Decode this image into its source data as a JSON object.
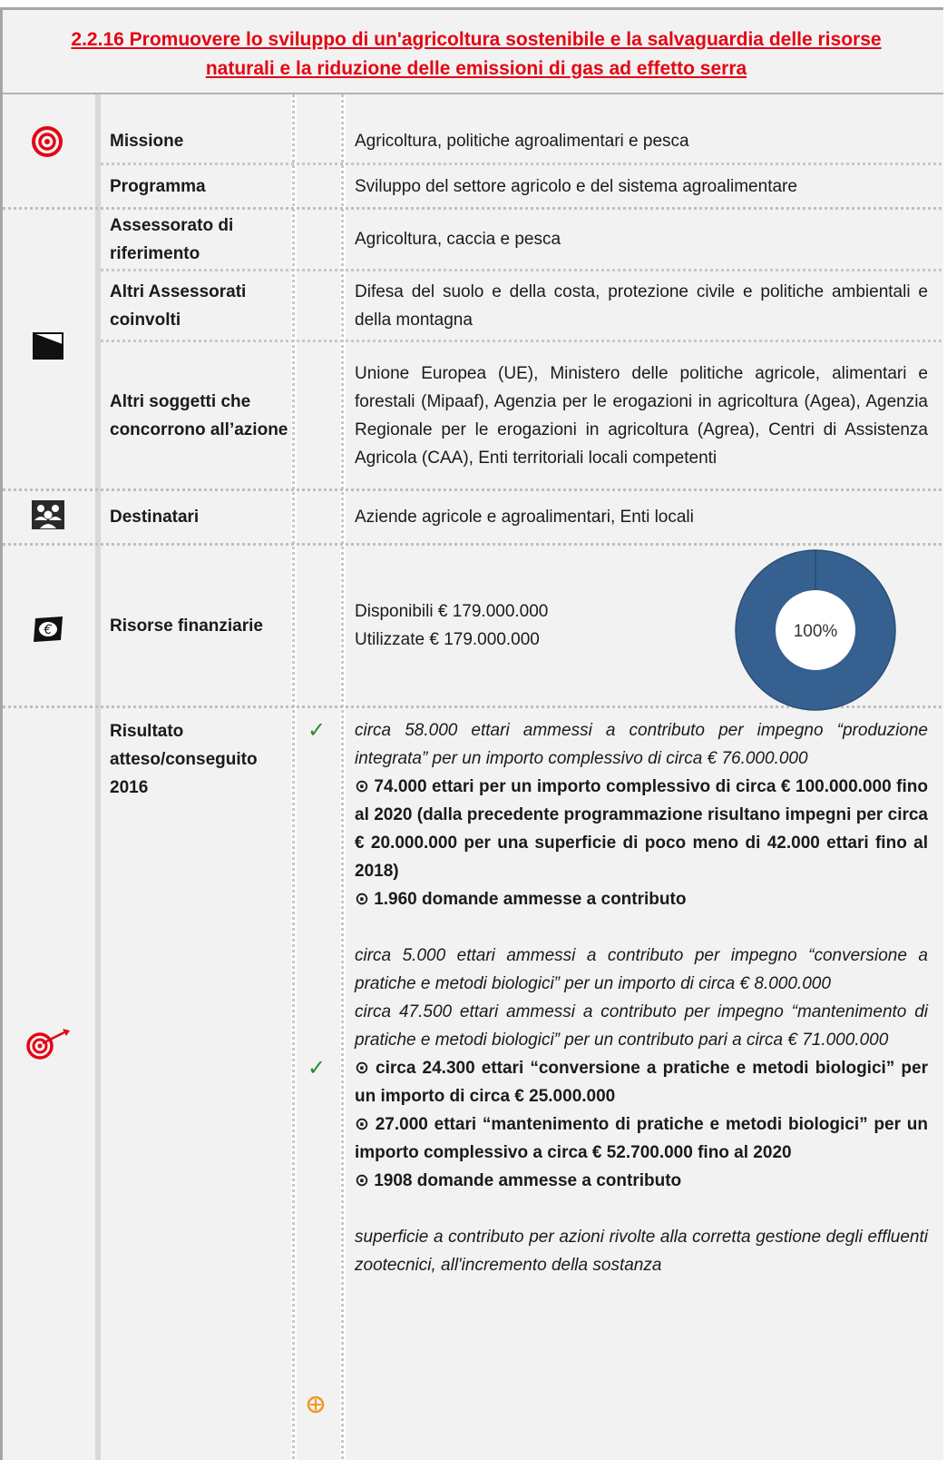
{
  "title": "2.2.16 Promuovere lo sviluppo di un'agricoltura sostenibile e la salvaguardia delle risorse naturali e la riduzione delle emissioni di gas ad effetto serra",
  "rows": {
    "missione": {
      "label": "Missione",
      "value": "Agricoltura, politiche agroalimentari e pesca"
    },
    "programma": {
      "label": "Programma",
      "value": "Sviluppo del settore agricolo e del sistema agroalimentare"
    },
    "assessorato": {
      "label": "Assessorato di riferimento",
      "value": "Agricoltura, caccia e pesca"
    },
    "altri_assessorati": {
      "label": "Altri Assessorati coinvolti",
      "value": "Difesa del suolo e della costa, protezione civile e politiche ambientali e della montagna"
    },
    "altri_soggetti": {
      "label": "Altri soggetti che concorrono all’azione",
      "value": "Unione Europea (UE), Ministero delle politiche agricole, alimentari e forestali (Mipaaf), Agenzia per le erogazioni in agricoltura (Agea), Agenzia Regionale per le erogazioni in agricoltura (Agrea), Centri di Assistenza Agricola (CAA), Enti territoriali locali competenti"
    },
    "destinatari": {
      "label": "Destinatari",
      "value": "Aziende agricole e agroalimentari, Enti locali"
    },
    "risorse": {
      "label": "Risorse finanziarie",
      "disponibili": "Disponibili € 179.000.000",
      "utilizzate": "Utilizzate € 179.000.000",
      "percent_label": "100%"
    },
    "risultato": {
      "label": "Risultato atteso/conseguito 2016"
    }
  },
  "chart_data": {
    "type": "pie",
    "values": [
      100
    ],
    "center_label": "100%",
    "color": "#35608f"
  },
  "results": {
    "group1": {
      "mark": "✓",
      "item1": "circa 58.000 ettari ammessi a contributo per impegno “produzione integrata” per un importo complessivo di circa € 76.000.000",
      "item2": "⊙ 74.000 ettari per un importo complessivo di circa € 100.000.000 fino al 2020 (dalla precedente programmazione risultano impegni per circa € 20.000.000 per una superficie di poco meno di 42.000 ettari fino al 2018)",
      "item3": "⊙ 1.960 domande ammesse a contributo"
    },
    "group2": {
      "mark": "✓",
      "item1": "circa 5.000 ettari ammessi a contributo per impegno “conversione a pratiche e metodi biologici” per un importo di circa € 8.000.000",
      "item2": "circa 47.500 ettari ammessi a contributo per impegno “mantenimento di pratiche e metodi biologici” per un contributo pari a circa € 71.000.000",
      "item3": "⊙ circa 24.300 ettari “conversione a pratiche e metodi biologici” per un importo di circa € 25.000.000",
      "item4": "⊙ 27.000 ettari “mantenimento di pratiche e metodi biologici” per un importo complessivo a circa € 52.700.000 fino al 2020",
      "item5": "⊙ 1908 domande ammesse a contributo"
    },
    "group3": {
      "item1": "superficie a contributo per azioni rivolte alla corretta gestione degli effluenti zootecnici, all'incremento della sostanza"
    }
  },
  "icons": {
    "target": "target-icon",
    "flag": "flag-icon",
    "people": "people-icon",
    "money": "euro-icon",
    "dart": "dart-target-icon",
    "clock": "orange-clock-icon"
  },
  "colors": {
    "title": "#e30613",
    "check": "#2e8b2e",
    "clock": "#f0961e",
    "pie": "#35608f"
  }
}
